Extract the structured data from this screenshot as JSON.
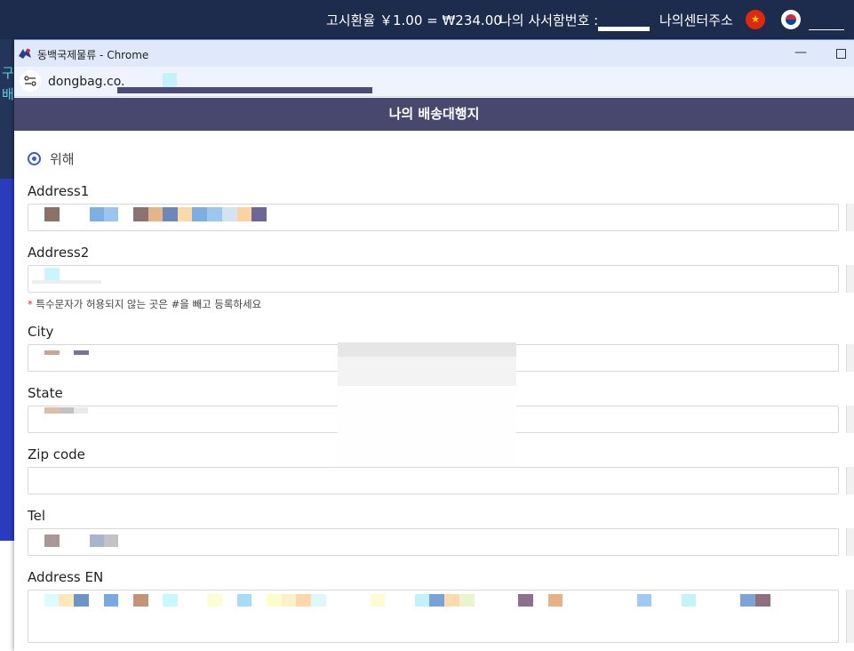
{
  "site_header": {
    "exchange_rate": "고시환율 ￥1.00 = ₩234.00",
    "po_box_label": "나의 사서함번호 :",
    "center_address": "나의센터주소",
    "flags": [
      "china-flag-icon",
      "korea-flag-icon"
    ]
  },
  "background": {
    "left_text": [
      "구",
      "배"
    ]
  },
  "window": {
    "title": "동백국제물류 - Chrome",
    "app_icon": "dongbaek-logo-icon",
    "min_label": "—"
  },
  "address_bar": {
    "url": "dongbag.co."
  },
  "modal": {
    "title": "나의 배송대행지"
  },
  "form": {
    "radio_option": "위해",
    "fields": [
      {
        "label": "Address1"
      },
      {
        "label": "Address2"
      },
      {
        "label": "City"
      },
      {
        "label": "State"
      },
      {
        "label": "Zip code"
      },
      {
        "label": "Tel"
      },
      {
        "label": "Address EN"
      }
    ],
    "note_star": "*",
    "note_text": "특수문자가 허용되지 않는 곳은 #을 빼고 등록하세요"
  },
  "colors": {
    "header_bg": "#1d2b4c",
    "modal_header_bg": "#48486f",
    "accent": "#3b5bcf"
  }
}
